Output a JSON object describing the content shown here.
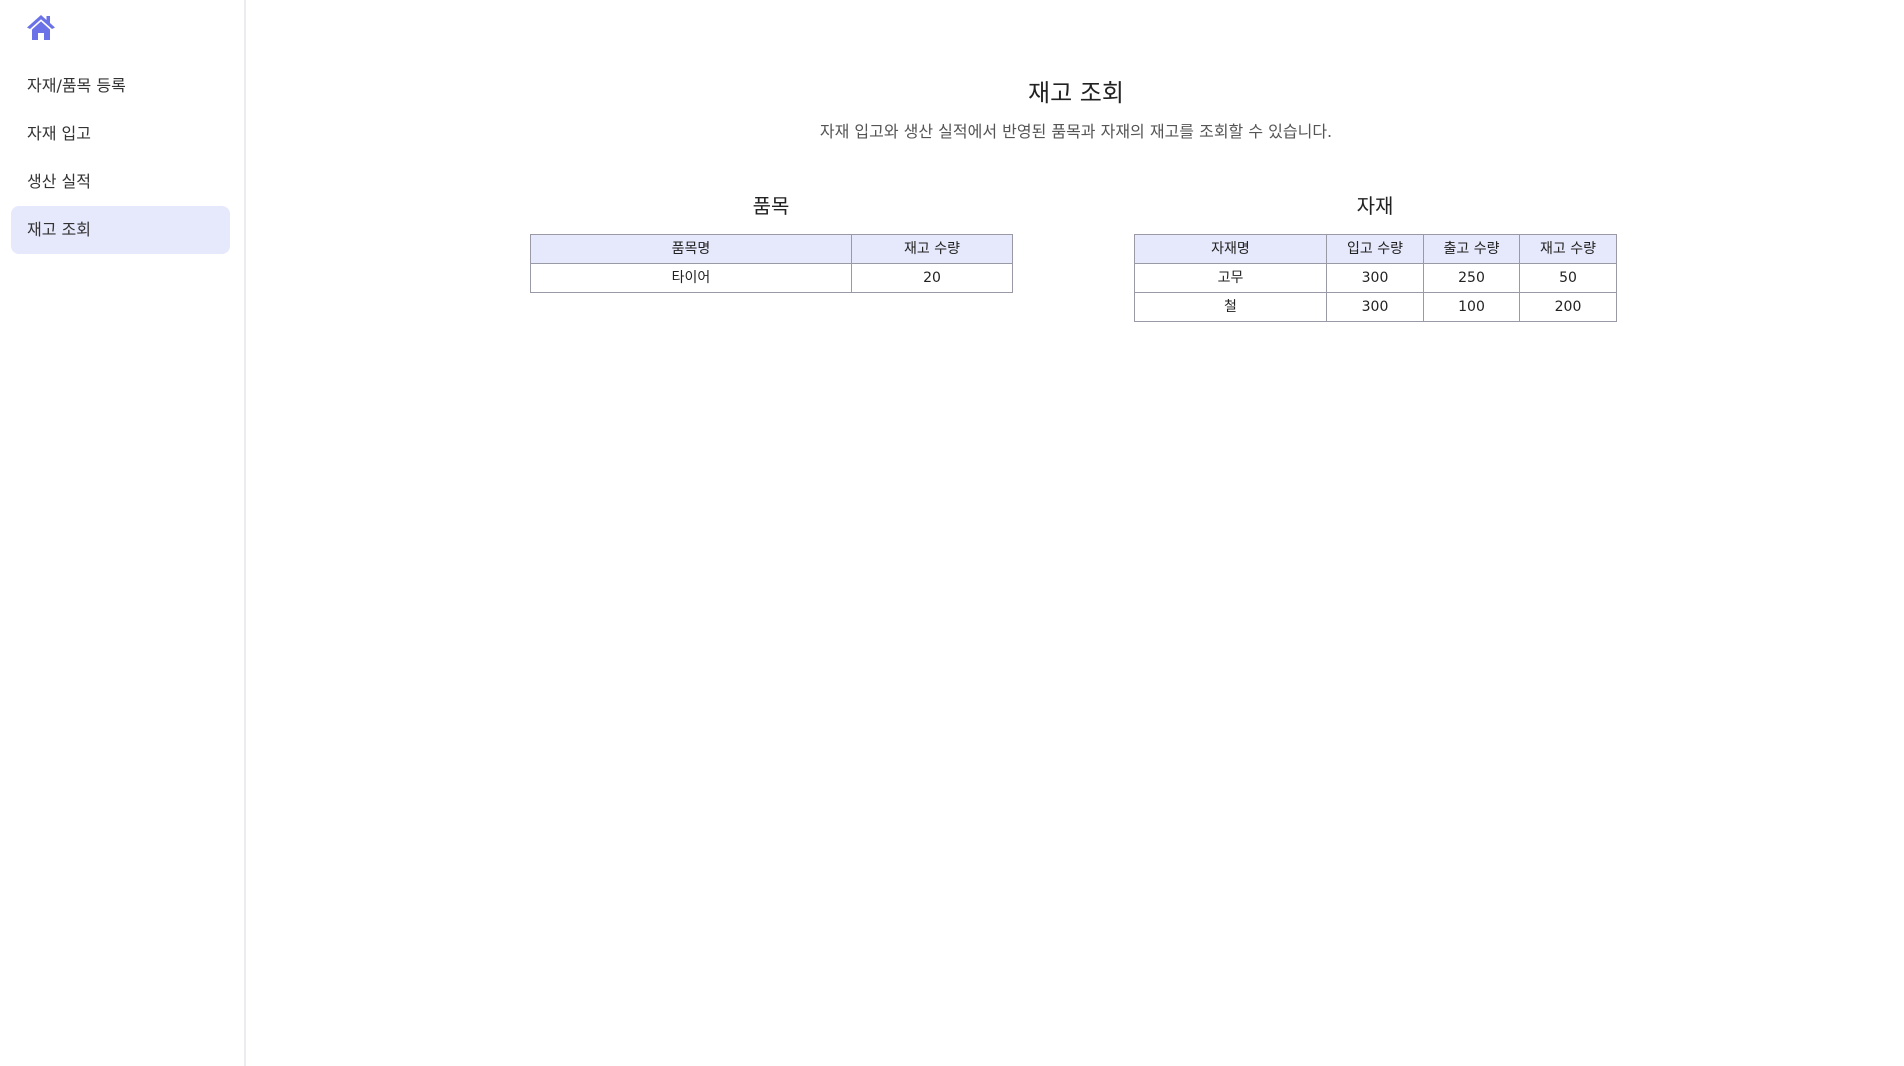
{
  "sidebar": {
    "home_icon": "home-icon",
    "accent_color": "#6b72e8",
    "active_bg": "#e6e8fb",
    "items": [
      {
        "label": "자재/품목 등록",
        "active": false
      },
      {
        "label": "자재 입고",
        "active": false
      },
      {
        "label": "생산 실적",
        "active": false
      },
      {
        "label": "재고 조회",
        "active": true
      }
    ]
  },
  "main": {
    "title": "재고 조회",
    "description": "자재 입고와 생산 실적에서 반영된 품목과 자재의 재고를 조회할 수 있습니다.",
    "items_section": {
      "title": "품목",
      "columns": [
        "품목명",
        "재고 수량"
      ],
      "rows": [
        [
          "타이어",
          "20"
        ]
      ]
    },
    "materials_section": {
      "title": "자재",
      "columns": [
        "자재명",
        "입고 수량",
        "출고 수량",
        "재고 수량"
      ],
      "rows": [
        [
          "고무",
          "300",
          "250",
          "50"
        ],
        [
          "철",
          "300",
          "100",
          "200"
        ]
      ]
    }
  }
}
